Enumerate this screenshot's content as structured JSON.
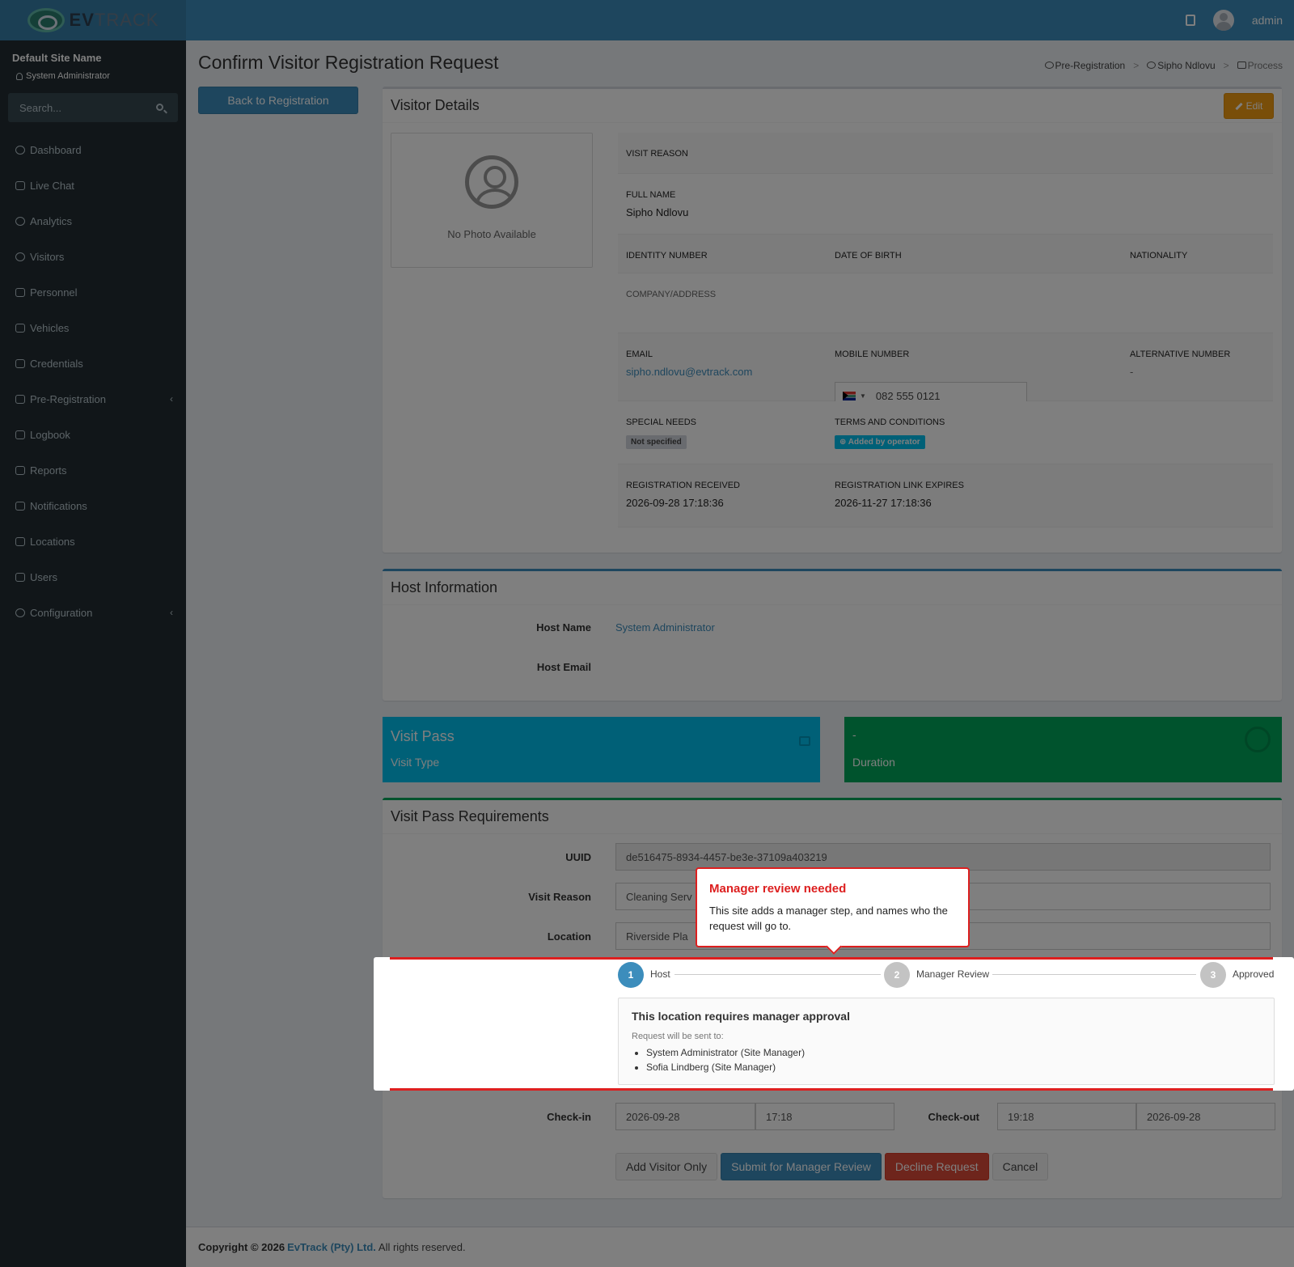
{
  "brand": {
    "name_bold": "EV",
    "name_rest": "TRACK"
  },
  "header": {
    "user": "admin"
  },
  "sidebar": {
    "site_name": "Default Site Name",
    "role": "System Administrator",
    "search_placeholder": "Search...",
    "items": [
      {
        "label": "Dashboard"
      },
      {
        "label": "Live Chat"
      },
      {
        "label": "Analytics"
      },
      {
        "label": "Visitors"
      },
      {
        "label": "Personnel"
      },
      {
        "label": "Vehicles"
      },
      {
        "label": "Credentials"
      },
      {
        "label": "Pre-Registration"
      },
      {
        "label": "Logbook"
      },
      {
        "label": "Reports"
      },
      {
        "label": "Notifications"
      },
      {
        "label": "Locations"
      },
      {
        "label": "Users"
      },
      {
        "label": "Configuration"
      }
    ]
  },
  "page": {
    "title": "Confirm Visitor Registration Request",
    "back_button": "Back to Registration"
  },
  "breadcrumb": {
    "item1": "Pre-Registration",
    "item2": "Sipho Ndlovu",
    "item3": "Process"
  },
  "visitor": {
    "title": "Visitor Details",
    "edit_label": "Edit",
    "no_photo": "No Photo Available",
    "visit_reason_label": "VISIT REASON",
    "full_name_label": "FULL NAME",
    "full_name": "Sipho Ndlovu",
    "identity_label": "IDENTITY NUMBER",
    "dob_label": "DATE OF BIRTH",
    "nationality_label": "NATIONALITY",
    "company_label": "COMPANY/ADDRESS",
    "email_label": "EMAIL",
    "email": "sipho.ndlovu@evtrack.com",
    "mobile_label": "MOBILE NUMBER",
    "mobile": "082 555 0121",
    "alt_label": "ALTERNATIVE NUMBER",
    "alt_value": "-",
    "special_label": "SPECIAL NEEDS",
    "special_value": "Not specified",
    "terms_label": "TERMS AND CONDITIONS",
    "terms_value": "Added by operator",
    "received_label": "REGISTRATION RECEIVED",
    "received_value": "2026-09-28 17:18:36",
    "expires_label": "REGISTRATION LINK EXPIRES",
    "expires_value": "2026-11-27 17:18:36"
  },
  "host": {
    "title": "Host Information",
    "name_label": "Host Name",
    "name_value": "System Administrator",
    "email_label": "Host Email"
  },
  "tiles": {
    "pass_title": "Visit Pass",
    "pass_sub": "Visit Type",
    "duration_value": "-",
    "duration_label": "Duration"
  },
  "requirements": {
    "title": "Visit Pass Requirements",
    "uuid_label": "UUID",
    "uuid_value": "de516475-8934-4457-be3e-37109a403219",
    "reason_label": "Visit Reason",
    "reason_value": "Cleaning Serv",
    "location_label": "Location",
    "location_value": "Riverside Pla",
    "checkin_label": "Check-in",
    "checkin_date": "2026-09-28",
    "checkin_time": "17:18",
    "checkout_label": "Check-out",
    "checkout_time": "19:18",
    "checkout_date": "2026-09-28"
  },
  "stepper": {
    "steps": [
      {
        "num": "1",
        "label": "Host"
      },
      {
        "num": "2",
        "label": "Manager Review"
      },
      {
        "num": "3",
        "label": "Approved"
      }
    ]
  },
  "approval": {
    "title": "This location requires manager approval",
    "subtitle": "Request will be sent to:",
    "recipients": [
      "System Administrator (Site Manager)",
      "Sofia Lindberg (Site Manager)"
    ]
  },
  "callout": {
    "title": "Manager review needed",
    "text": "This site adds a manager step, and names who the request will go to."
  },
  "actions": {
    "add_only": "Add Visitor Only",
    "submit": "Submit for Manager Review",
    "decline": "Decline Request",
    "cancel": "Cancel"
  },
  "footer": {
    "prefix": "Copyright © 2026",
    "company": "EvTrack (Pty) Ltd.",
    "suffix": "All rights reserved."
  },
  "colors": {
    "accent": "#3c8dbc",
    "sidebar": "#222d32",
    "callout_red": "#dd1f1f",
    "tile_blue": "#00c0ef",
    "tile_green": "#00a65a"
  }
}
